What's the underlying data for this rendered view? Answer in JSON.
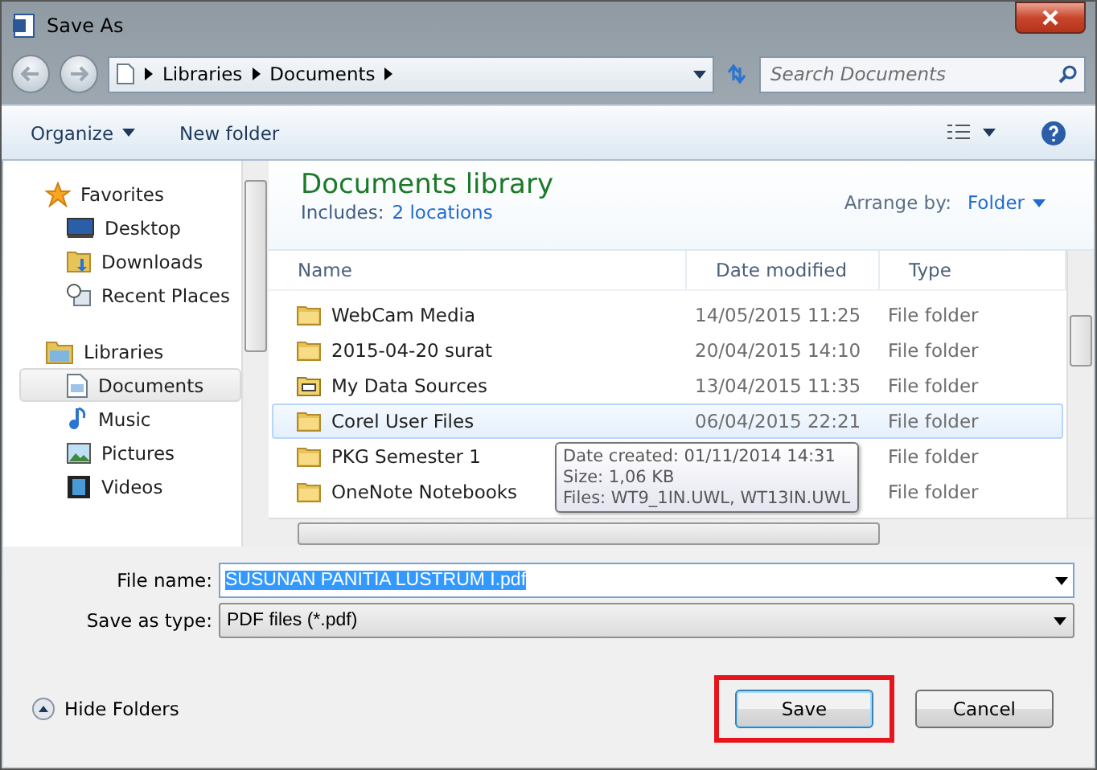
{
  "window": {
    "title": "Save As"
  },
  "address": {
    "path": [
      "Libraries",
      "Documents"
    ],
    "search_placeholder": "Search Documents"
  },
  "toolbar": {
    "organize": "Organize",
    "new_folder": "New folder"
  },
  "sidebar": [
    {
      "label": "Favorites",
      "kind": "star",
      "children": [
        {
          "label": "Desktop",
          "kind": "desktop",
          "selected": false
        },
        {
          "label": "Downloads",
          "kind": "downloads",
          "selected": false
        },
        {
          "label": "Recent Places",
          "kind": "recent",
          "selected": false
        }
      ]
    },
    {
      "label": "Libraries",
      "kind": "library",
      "children": [
        {
          "label": "Documents",
          "kind": "document",
          "selected": true
        },
        {
          "label": "Music",
          "kind": "music",
          "selected": false
        },
        {
          "label": "Pictures",
          "kind": "pictures",
          "selected": false
        },
        {
          "label": "Videos",
          "kind": "videos",
          "selected": false
        }
      ]
    }
  ],
  "library": {
    "title": "Documents library",
    "includes_label": "Includes:",
    "includes_link": "2 locations",
    "arrange_label": "Arrange by:",
    "arrange_value": "Folder"
  },
  "columns": [
    "Name",
    "Date modified",
    "Type"
  ],
  "rows": [
    {
      "name": "WebCam Media",
      "kind": "folder",
      "date": "14/05/2015 11:25",
      "type": "File folder",
      "selected": false
    },
    {
      "name": "2015-04-20 surat",
      "kind": "folder",
      "date": "20/04/2015 14:10",
      "type": "File folder",
      "selected": false
    },
    {
      "name": "My Data Sources",
      "kind": "datasource",
      "date": "13/04/2015 11:35",
      "type": "File folder",
      "selected": false
    },
    {
      "name": "Corel User Files",
      "kind": "folder",
      "date": "06/04/2015 22:21",
      "type": "File folder",
      "selected": true
    },
    {
      "name": "PKG Semester 1",
      "kind": "folder",
      "type": "File folder",
      "selected": false
    },
    {
      "name": "OneNote Notebooks",
      "kind": "folder",
      "type": "File folder",
      "selected": false
    }
  ],
  "tooltip": [
    "Date created: 01/11/2014 14:31",
    "Size: 1,06 KB",
    "Files: WT9_1IN.UWL, WT13IN.UWL"
  ],
  "form": {
    "file_name_label": "File name:",
    "file_name": "SUSUNAN PANITIA LUSTRUM I.pdf",
    "type_label": "Save as type:",
    "type_value": "PDF files (*.pdf)"
  },
  "footer": {
    "hide_folders": "Hide Folders",
    "buttons": [
      {
        "label": "Save",
        "highlighted": true
      },
      {
        "label": "Cancel",
        "highlighted": false
      }
    ]
  }
}
